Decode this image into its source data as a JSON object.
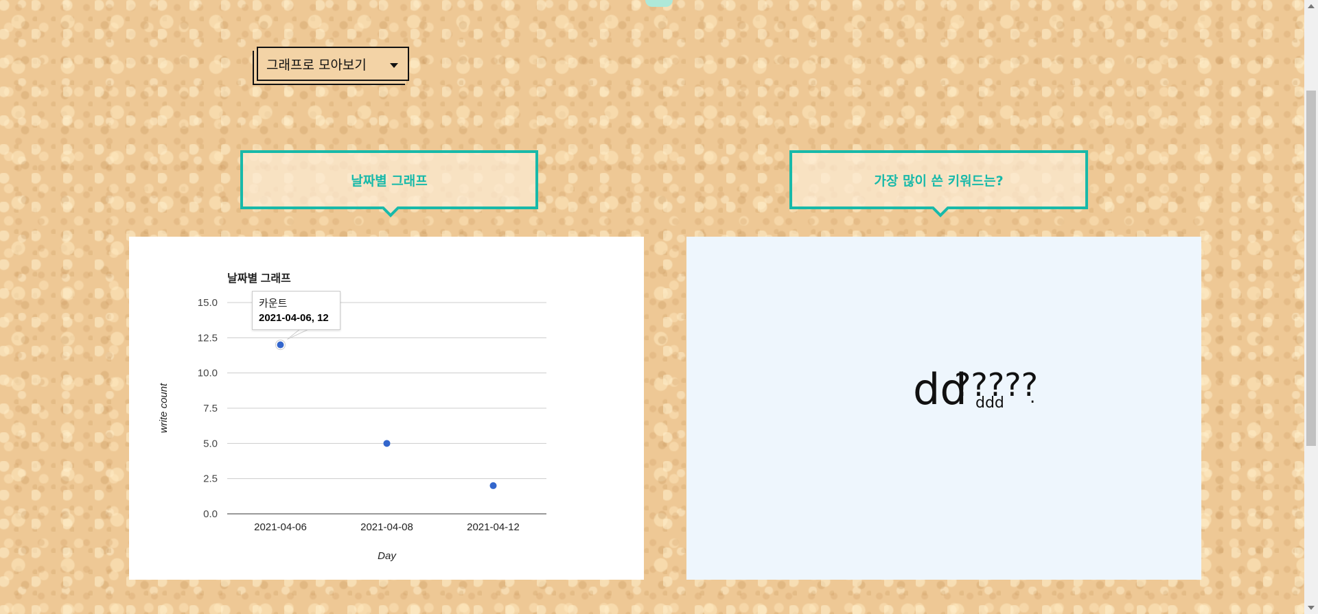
{
  "dropdown": {
    "label": "그래프로 모아보기",
    "icon": "caret-down-icon"
  },
  "headings": {
    "date_graph": "날짜별 그래프",
    "keywords": "가장 많이 쓴 키워드는?"
  },
  "chart_data": {
    "type": "scatter",
    "title": "날짜별 그래프",
    "xlabel": "Day",
    "ylabel": "write count",
    "categories": [
      "2021-04-06",
      "2021-04-08",
      "2021-04-12"
    ],
    "series": [
      {
        "name": "카운트",
        "values": [
          12,
          5,
          2
        ]
      }
    ],
    "ylim": [
      0,
      15
    ],
    "yticks": [
      "0.0",
      "2.5",
      "5.0",
      "7.5",
      "10.0",
      "12.5",
      "15.0"
    ],
    "grid": true,
    "point_color": "#3366cc"
  },
  "tooltip": {
    "series": "카운트",
    "value": "2021-04-06, 12"
  },
  "word_cloud": {
    "words": [
      "dd",
      "?????",
      "ddd",
      "."
    ]
  },
  "colors": {
    "accent": "#18b9a9",
    "cloud_bg": "#eef6fd"
  }
}
